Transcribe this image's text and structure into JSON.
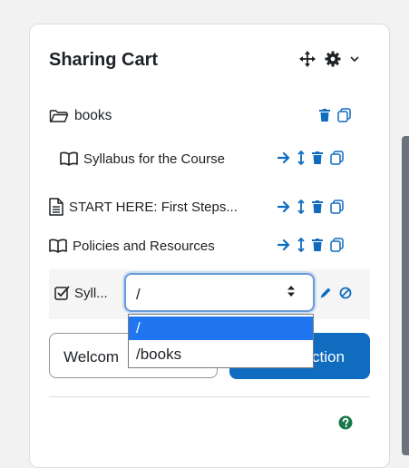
{
  "block": {
    "title": "Sharing Cart"
  },
  "items": [
    {
      "label": "books",
      "icon": "folder-icon"
    },
    {
      "label": "Syllabus for the Course",
      "icon": "book-icon"
    },
    {
      "label": "START HERE: First Steps...",
      "icon": "page-icon"
    },
    {
      "label": "Policies and Resources",
      "icon": "book-icon"
    },
    {
      "label": "Syll...",
      "icon": "assignment-icon"
    }
  ],
  "move_select": {
    "value": "/",
    "options": [
      "/",
      "/books"
    ]
  },
  "welcome_input": {
    "value": "Welcom"
  },
  "primary_button": {
    "label": "ction"
  },
  "colors": {
    "accent": "#0f6cbf",
    "selected_option": "#1f76f0",
    "help": "#1a7a4c"
  }
}
